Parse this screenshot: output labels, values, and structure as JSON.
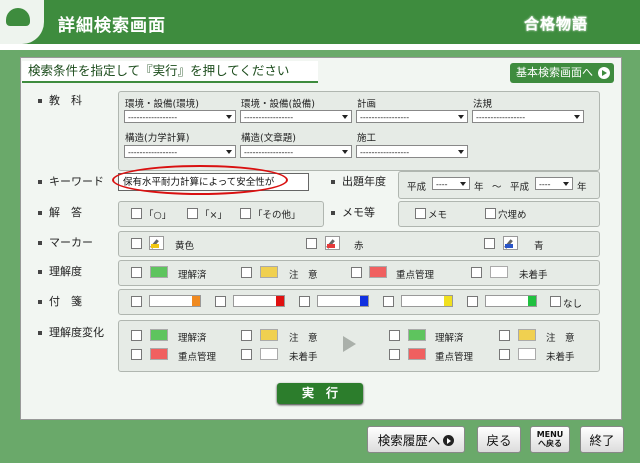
{
  "header": {
    "title": "詳細検索画面",
    "brand": "合格物語"
  },
  "headline": "検索条件を指定して『実行』を押してください",
  "basic_search_button": "基本検索画面へ",
  "labels": {
    "subject": "教　科",
    "keyword": "キーワード",
    "answer": "解　答",
    "marker": "マーカー",
    "understanding": "理解度",
    "sticky": "付　箋",
    "understanding_change": "理解度変化",
    "year": "出題年度",
    "memo": "メモ等"
  },
  "subjects": [
    {
      "label": "環境・設備(環境)",
      "value": "-----------------"
    },
    {
      "label": "環境・設備(設備)",
      "value": "-----------------"
    },
    {
      "label": "計画",
      "value": "-----------------"
    },
    {
      "label": "法規",
      "value": "-----------------"
    },
    {
      "label": "構造(力学計算)",
      "value": "-----------------"
    },
    {
      "label": "構造(文章題)",
      "value": "-----------------"
    },
    {
      "label": "施工",
      "value": "-----------------"
    }
  ],
  "keyword_value": "保有水平耐力計算によって安全性が",
  "year": {
    "from_era": "平成",
    "from_value": "----",
    "from_unit": "年",
    "sep": "～",
    "to_era": "平成",
    "to_value": "----",
    "to_unit": "年"
  },
  "answer_options": [
    "「○」",
    "「×」",
    "「その他」"
  ],
  "memo_options": [
    "メモ",
    "穴埋め"
  ],
  "marker_options": [
    {
      "label": "黄色",
      "color": "#f2c811"
    },
    {
      "label": "赤",
      "color": "#e53a3a"
    },
    {
      "label": "青",
      "color": "#2a55c8"
    }
  ],
  "understanding_options": [
    {
      "label": "理解済",
      "color": "#5ec45e"
    },
    {
      "label": "注　意",
      "color": "#f0d050"
    },
    {
      "label": "重点管理",
      "color": "#f06060"
    },
    {
      "label": "未着手",
      "color": "#ffffff"
    }
  ],
  "sticky_colors": [
    "#f08a20",
    "#e01010",
    "#1030e0",
    "#f0e020",
    "#20c040"
  ],
  "sticky_none": "なし",
  "change_from": [
    {
      "label": "理解済",
      "color": "#5ec45e"
    },
    {
      "label": "注　意",
      "color": "#f0d050"
    },
    {
      "label": "重点管理",
      "color": "#f06060"
    },
    {
      "label": "未着手",
      "color": "#ffffff"
    }
  ],
  "change_to": [
    {
      "label": "理解済",
      "color": "#5ec45e"
    },
    {
      "label": "注　意",
      "color": "#f0d050"
    },
    {
      "label": "重点管理",
      "color": "#f06060"
    },
    {
      "label": "未着手",
      "color": "#ffffff"
    }
  ],
  "execute_button": "実　行",
  "footer": {
    "history": "検索履歴へ",
    "back": "戻る",
    "menu_top": "MENU",
    "menu_bottom": "へ戻る",
    "quit": "終了"
  }
}
